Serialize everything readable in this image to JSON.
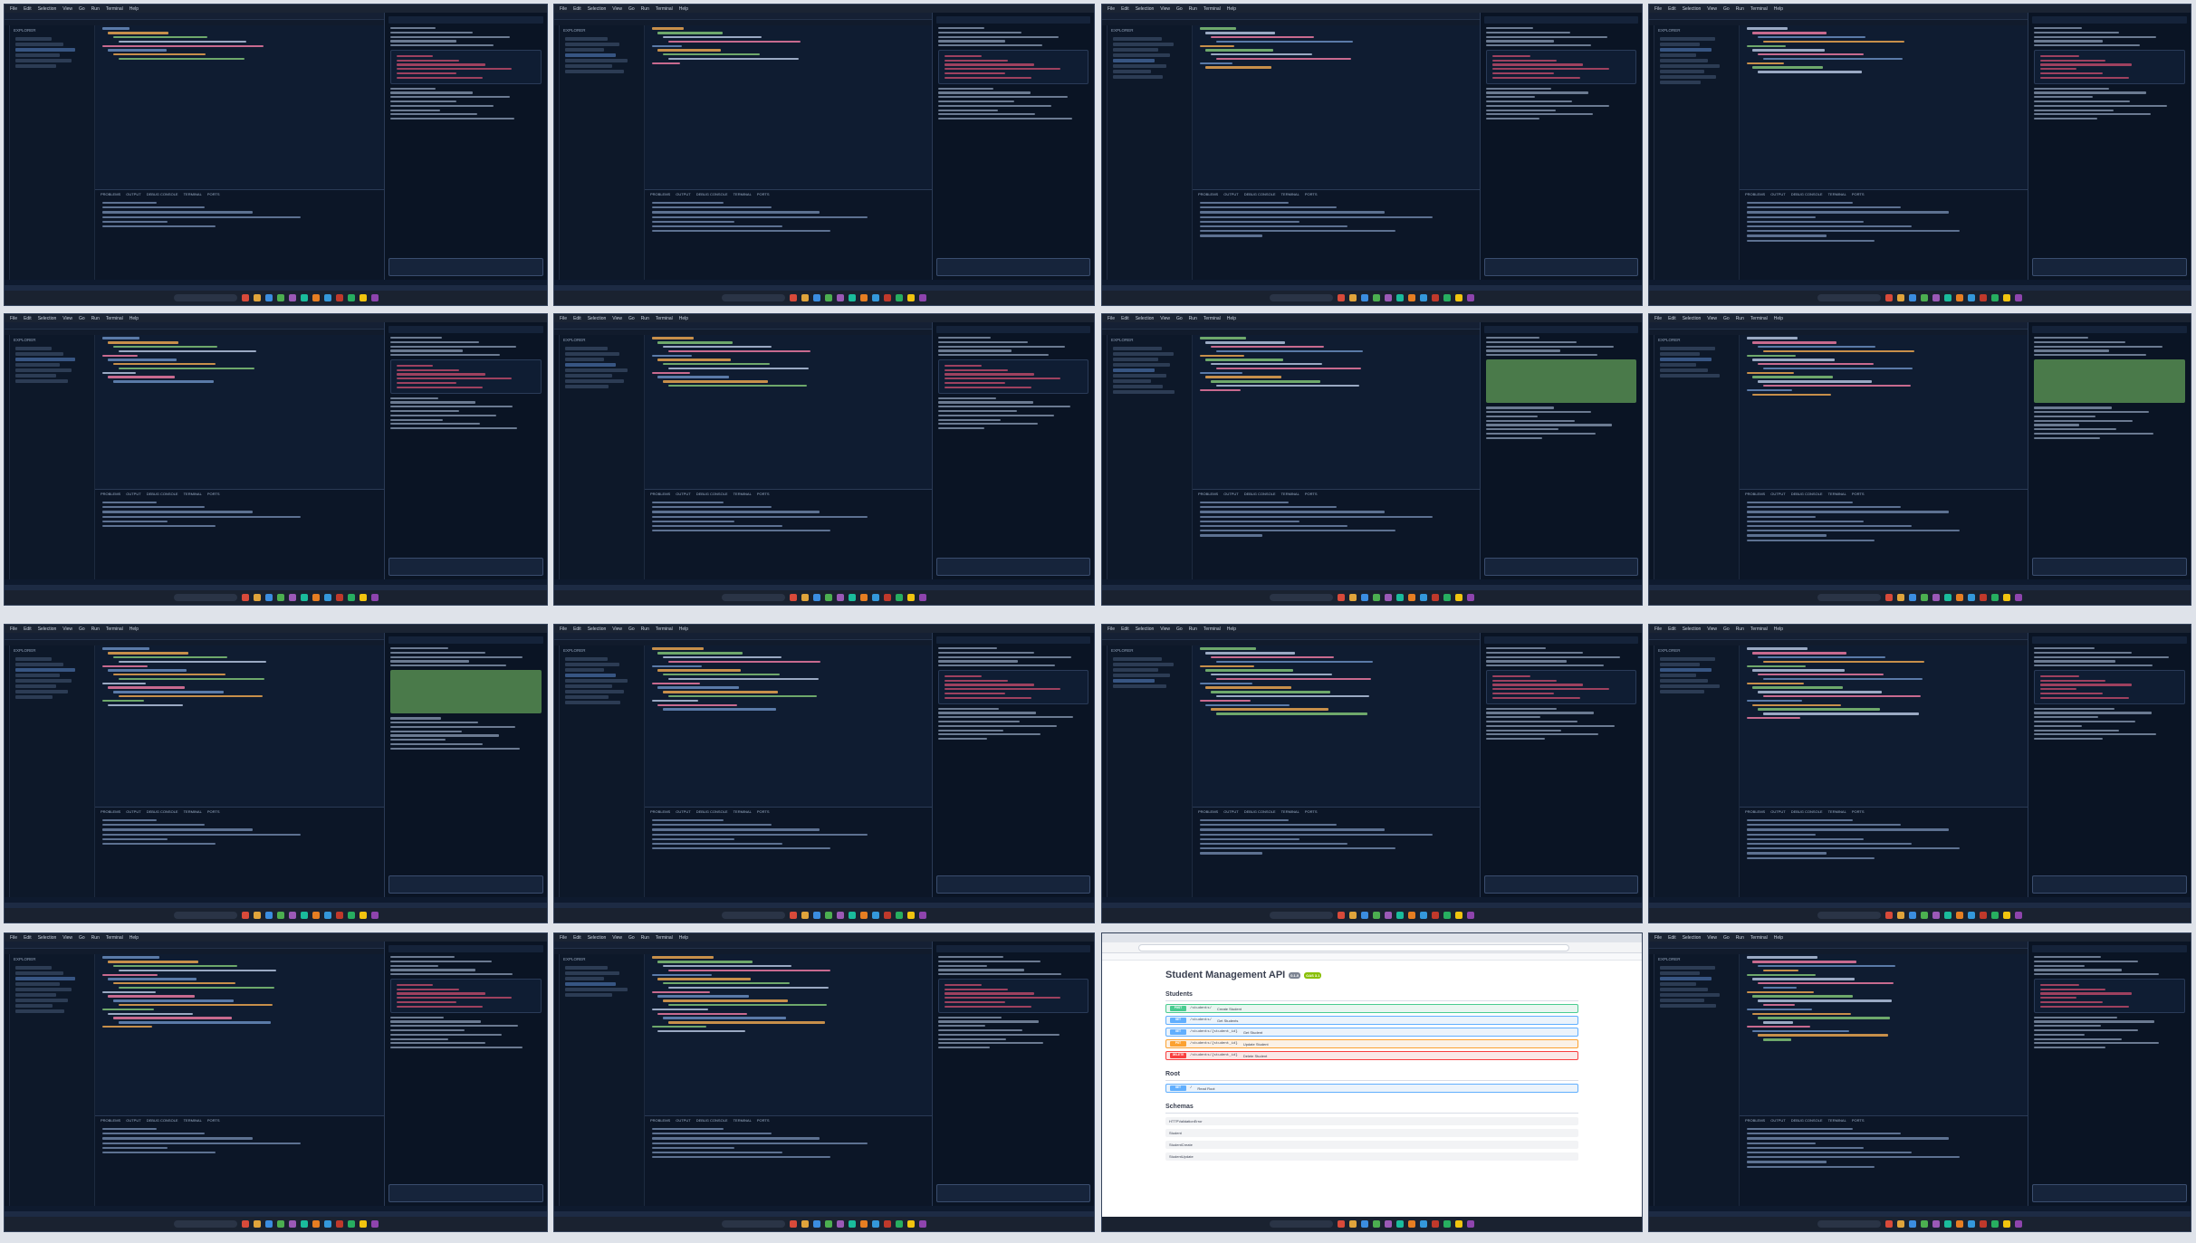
{
  "grid": {
    "rows": 4,
    "cols": 4
  },
  "ide": {
    "menu_items": [
      "File",
      "Edit",
      "Selection",
      "View",
      "Go",
      "Run",
      "Terminal",
      "Help"
    ],
    "explorer_title": "EXPLORER",
    "panel_tabs": [
      "PROBLEMS",
      "OUTPUT",
      "DEBUG CONSOLE",
      "TERMINAL",
      "PORTS"
    ]
  },
  "browser": {
    "page_title": "Student Management API",
    "badge_version": "0.1.0",
    "badge_oas": "OAS 3.1",
    "sections": {
      "students": "Students",
      "root": "Root",
      "schemas": "Schemas"
    },
    "operations": [
      {
        "method": "POST",
        "path": "/students/",
        "summary": "Create Student",
        "kind": "post"
      },
      {
        "method": "GET",
        "path": "/students/",
        "summary": "Get Students",
        "kind": "get"
      },
      {
        "method": "GET",
        "path": "/students/{student_id}",
        "summary": "Get Student",
        "kind": "get"
      },
      {
        "method": "PUT",
        "path": "/students/{student_id}",
        "summary": "Update Student",
        "kind": "put"
      },
      {
        "method": "DELETE",
        "path": "/students/{student_id}",
        "summary": "Delete Student",
        "kind": "del"
      }
    ],
    "root_operation": {
      "method": "GET",
      "path": "/",
      "summary": "Read Root",
      "kind": "get"
    },
    "schemas": [
      "HTTPValidationError",
      "Student",
      "StudentCreate",
      "StudentUpdate"
    ]
  },
  "colors": {
    "ide_bg": "#0e1a2e",
    "chat_code": "#c24b6a",
    "diff_green": "#4a7a4a",
    "accent": "#4a6fa8"
  }
}
